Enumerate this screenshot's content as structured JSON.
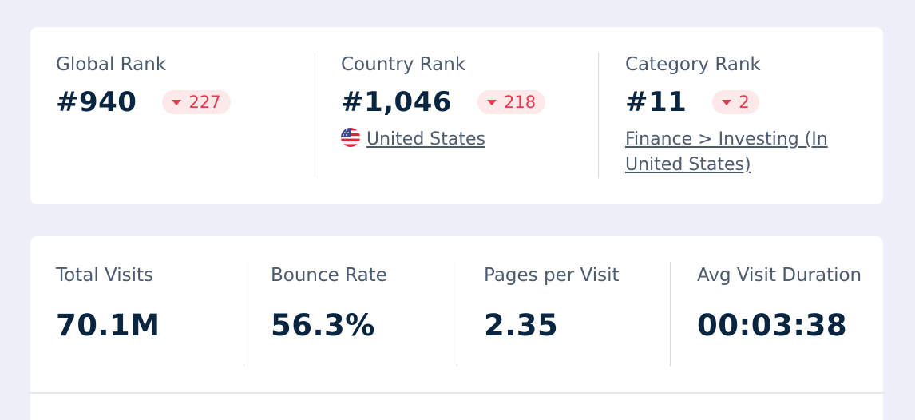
{
  "ranks": {
    "global": {
      "label": "Global Rank",
      "value": "#940",
      "change": "227"
    },
    "country": {
      "label": "Country Rank",
      "value": "#1,046",
      "change": "218",
      "country_name": "United States"
    },
    "category": {
      "label": "Category Rank",
      "value": "#11",
      "change": "2",
      "category_line1": "Finance > Investing (In",
      "category_line2": "United States)"
    }
  },
  "stats": {
    "total_visits": {
      "label": "Total Visits",
      "value": "70.1M"
    },
    "bounce_rate": {
      "label": "Bounce Rate",
      "value": "56.3%"
    },
    "pages_per_visit": {
      "label": "Pages per Visit",
      "value": "2.35"
    },
    "avg_visit_duration": {
      "label": "Avg Visit Duration",
      "value": "00:03:38"
    }
  },
  "colors": {
    "decrease": "#e5394c",
    "decrease_bg": "#fde8ea",
    "text_dark": "#092540",
    "text_muted": "#4d5b6e"
  }
}
